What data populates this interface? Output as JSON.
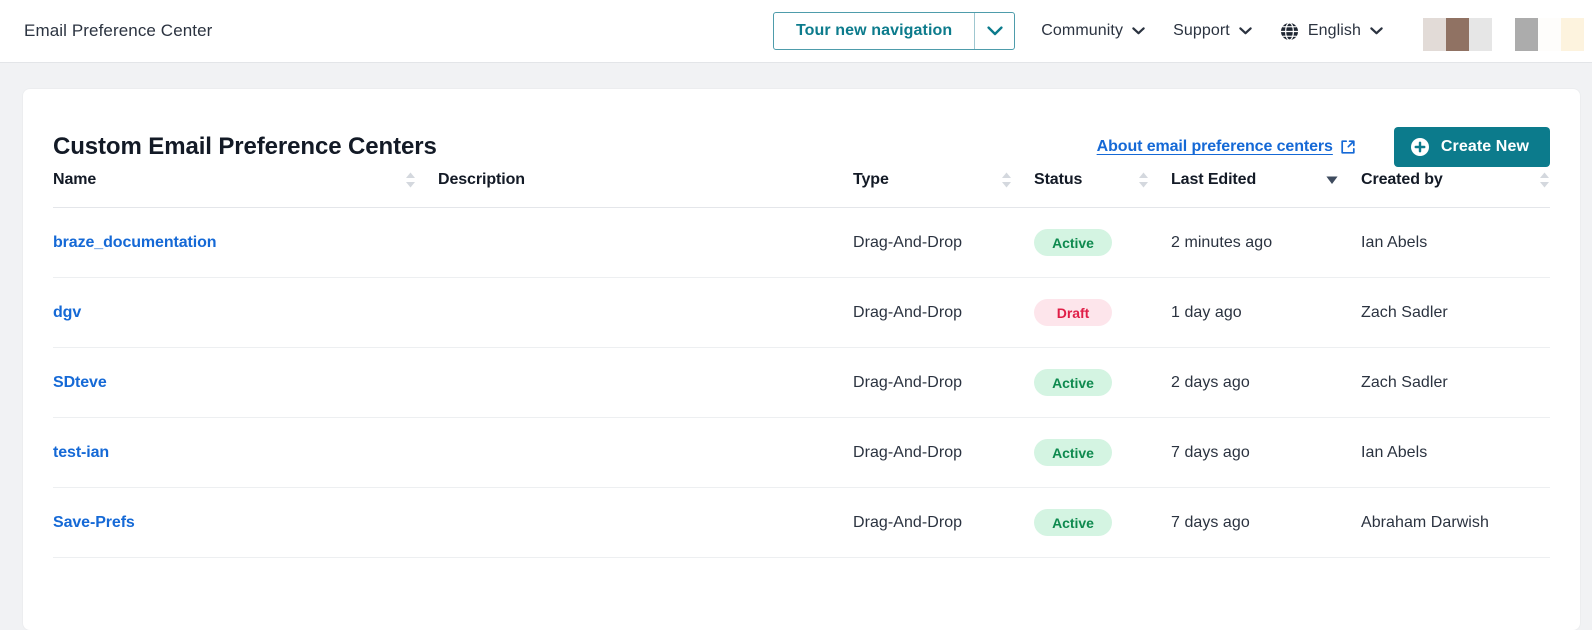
{
  "topbar": {
    "app_title": "Email Preference Center",
    "tour_button": {
      "label": "Tour new navigation",
      "caret_icon": "chevron-down-icon",
      "accent": "#0C7B8C"
    },
    "nav": [
      {
        "label": "Community",
        "caret_icon": "chevron-down-icon"
      },
      {
        "label": "Support",
        "caret_icon": "chevron-down-icon"
      }
    ],
    "language": {
      "icon": "globe-icon",
      "label": "English",
      "caret_icon": "chevron-down-icon"
    },
    "redacted_region": {
      "name": "redacted-avatar-area",
      "colors": [
        "#E2DBD7",
        "#907263",
        "#E6E6E6",
        "#FFFFFF",
        "#ACACAC",
        "#FEFDFB",
        "#FDF3DE"
      ]
    }
  },
  "card": {
    "title": "Custom Email Preference Centers",
    "about_link": {
      "label": "About email preference centers",
      "icon": "external-link-icon",
      "color": "#1569D6"
    },
    "create_button": {
      "label": "Create New",
      "icon": "plus-circle-icon",
      "color": "#0C7B8C"
    }
  },
  "table": {
    "columns": [
      {
        "label": "Name",
        "sort": "none"
      },
      {
        "label": "Description",
        "sort": "off"
      },
      {
        "label": "Type",
        "sort": "none"
      },
      {
        "label": "Status",
        "sort": "none"
      },
      {
        "label": "Last Edited",
        "sort": "desc"
      },
      {
        "label": "Created by",
        "sort": "none"
      }
    ],
    "rows": [
      {
        "name": "braze_documentation",
        "description": "",
        "type": "Drag-And-Drop",
        "status": "Active",
        "status_variant": "active",
        "last_edited": "2 minutes ago",
        "created_by": "Ian Abels"
      },
      {
        "name": "dgv",
        "description": "",
        "type": "Drag-And-Drop",
        "status": "Draft",
        "status_variant": "draft",
        "last_edited": "1 day ago",
        "created_by": "Zach Sadler"
      },
      {
        "name": "SDteve",
        "description": "",
        "type": "Drag-And-Drop",
        "status": "Active",
        "status_variant": "active",
        "last_edited": "2 days ago",
        "created_by": "Zach Sadler"
      },
      {
        "name": "test-ian",
        "description": "",
        "type": "Drag-And-Drop",
        "status": "Active",
        "status_variant": "active",
        "last_edited": "7 days ago",
        "created_by": "Ian Abels"
      },
      {
        "name": "Save-Prefs",
        "description": "",
        "type": "Drag-And-Drop",
        "status": "Active",
        "status_variant": "active",
        "last_edited": "7 days ago",
        "created_by": "Abraham Darwish"
      }
    ]
  }
}
